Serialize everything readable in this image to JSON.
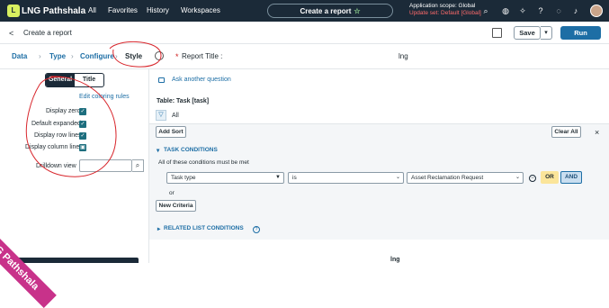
{
  "topbar": {
    "logo_mark": "L",
    "logo_text": "LNG Pathshala",
    "nav": [
      "All",
      "Favorites",
      "History",
      "Workspaces"
    ],
    "create_report": "Create a report",
    "star_icon": "star-icon",
    "scope_line": "Application scope: Global",
    "update_set": "Update set: Default [Global]",
    "icons": [
      "search-icon",
      "globe-icon",
      "sparkle-icon",
      "help-icon",
      "bell-icon"
    ]
  },
  "subbar": {
    "back_icon": "<",
    "title": "Create a report",
    "save_label": "Save",
    "save_caret": "▾",
    "run_label": "Run"
  },
  "steps": [
    {
      "label": "Data"
    },
    {
      "label": "Type"
    },
    {
      "label": "Configure"
    },
    {
      "label": "Style"
    }
  ],
  "report_title": {
    "required_mark": "*",
    "label": "Report Title :",
    "value": "lng"
  },
  "sidebar": {
    "tabs": [
      "General",
      "Title"
    ],
    "active_tab": "General",
    "edit_coloring": "Edit coloring rules",
    "options": [
      {
        "label": "Display zero",
        "checked": true
      },
      {
        "label": "Default expanded",
        "checked": true
      },
      {
        "label": "Display row lines",
        "checked": true
      },
      {
        "label": "Display column lines",
        "checked": true
      }
    ],
    "drilldown_label": "Drilldown view",
    "drilldown_value": ""
  },
  "main": {
    "ask_link": "Ask another question",
    "table_label": "Table: Task [task]",
    "all_label": "All",
    "add_sort": "Add Sort",
    "clear_all": "Clear All",
    "close_icon": "×",
    "task_conditions": "TASK CONDITIONS",
    "all_conditions": "All of these conditions must be met",
    "condition": {
      "field": "Task type",
      "operator": "is",
      "value": "Asset Reclamation Request"
    },
    "or_button": "OR",
    "and_button": "AND",
    "or_label": "or",
    "new_criteria": "New Criteria",
    "related_list": "RELATED LIST CONDITIONS",
    "preview_title": "lng"
  },
  "watermark": "LNG Pathshala",
  "colors": {
    "header_bg": "#1b2a38",
    "accent": "#1d6ea5",
    "update_set": "#ff6b6b",
    "annotation": "#d8262c",
    "watermark": "#c8328a"
  }
}
